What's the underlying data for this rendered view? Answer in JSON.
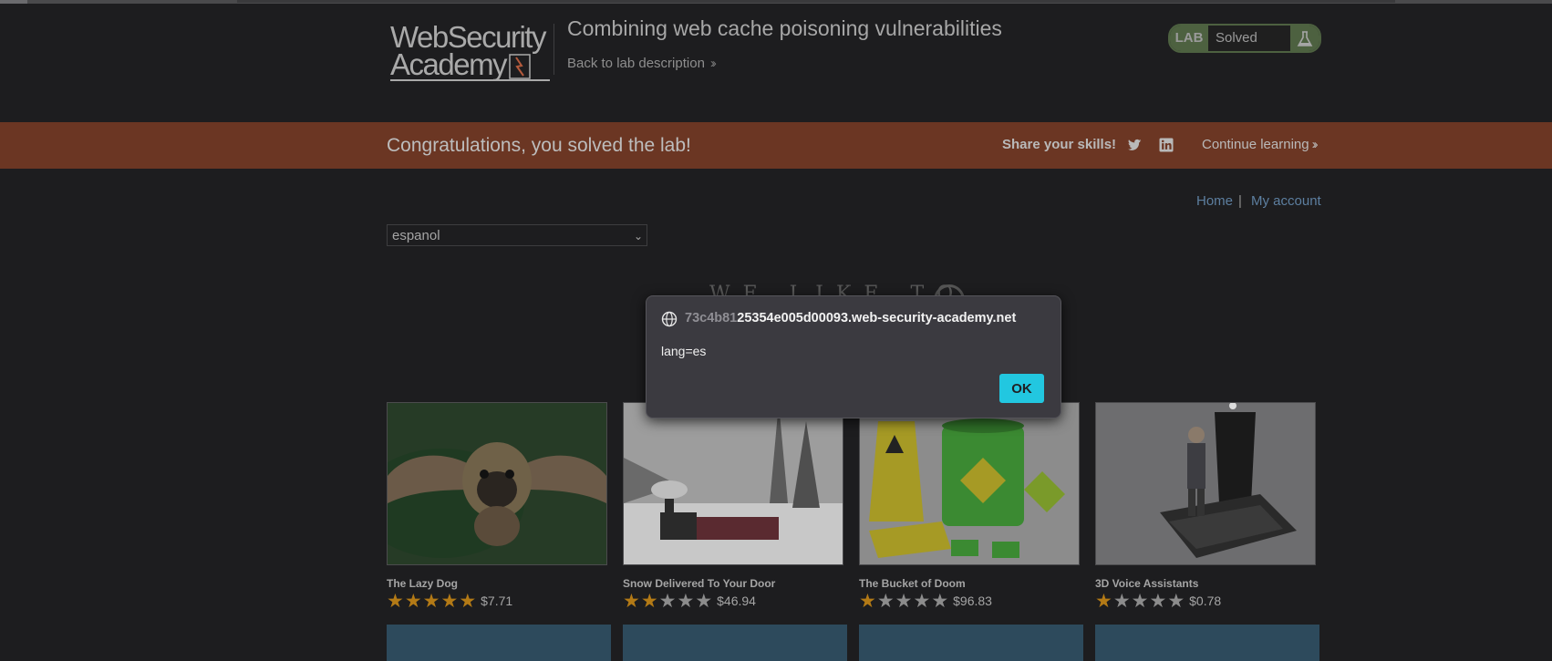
{
  "header": {
    "logo_line1": "WebSecurity",
    "logo_line2": "Academy",
    "lab_title": "Combining web cache poisoning vulnerabilities",
    "back_link": "Back to lab description",
    "lab_badge": "LAB",
    "lab_status": "Solved"
  },
  "banner": {
    "message": "Congratulations, you solved the lab!",
    "share_label": "Share your skills!",
    "continue_label": "Continue learning"
  },
  "nav": {
    "home": "Home",
    "separator": "|",
    "account": "My account"
  },
  "language_select": {
    "selected": "espanol"
  },
  "hero": {
    "text": "WE LIKE TO"
  },
  "products": [
    {
      "name": "The Lazy Dog",
      "rating": 5,
      "price": "$7.71"
    },
    {
      "name": "Snow Delivered To Your Door",
      "rating": 2,
      "price": "$46.94"
    },
    {
      "name": "The Bucket of Doom",
      "rating": 1,
      "price": "$96.83"
    },
    {
      "name": "3D Voice Assistants",
      "rating": 1,
      "price": "$0.78"
    }
  ],
  "dialog": {
    "origin_faded": "73c4b81",
    "origin_rest": "25354e005d00093.web-security-academy.net",
    "message": "lang=es",
    "ok_label": "OK"
  },
  "icons": {
    "globe": "globe-icon",
    "twitter": "twitter-icon",
    "linkedin": "linkedin-icon",
    "flask": "flask-icon"
  },
  "colors": {
    "banner_bg": "#6b3623",
    "lab_badge_bg": "#4d6140",
    "ok_button": "#22c7e0",
    "star_on": "#b37a16",
    "link": "#5d7fa0"
  }
}
